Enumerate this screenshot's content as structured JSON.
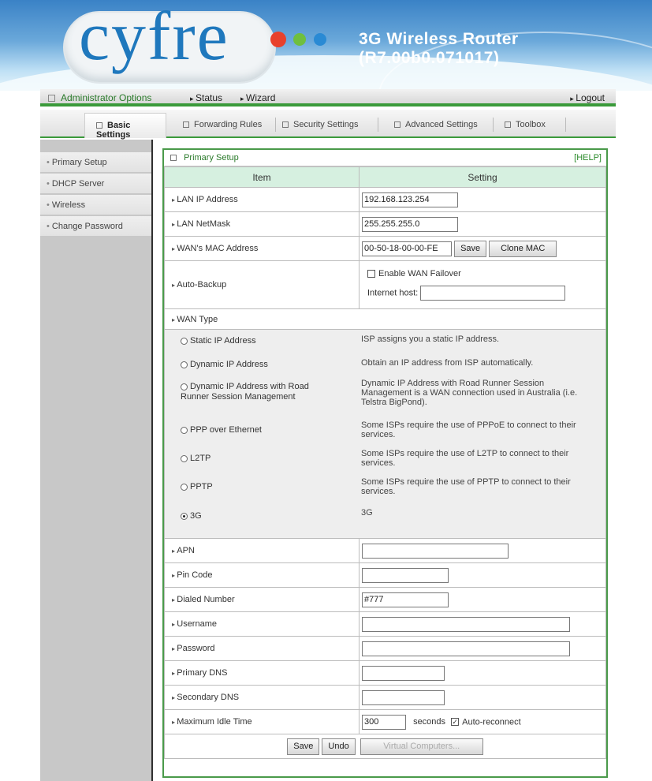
{
  "banner": {
    "logo": "cyfre",
    "product": "3G Wireless Router (R7.00b0.071017)"
  },
  "menu": {
    "admin": "Administrator Options",
    "status": "Status",
    "wizard": "Wizard",
    "logout": "Logout"
  },
  "tabs": [
    "Basic Settings",
    "Forwarding Rules",
    "Security Settings",
    "Advanced Settings",
    "Toolbox"
  ],
  "sidebar": [
    "Primary Setup",
    "DHCP Server",
    "Wireless",
    "Change Password"
  ],
  "panel": {
    "title": "Primary Setup",
    "help": "[HELP]",
    "col_item": "Item",
    "col_setting": "Setting"
  },
  "fields": {
    "lan_ip": {
      "label": "LAN IP Address",
      "value": "192.168.123.254"
    },
    "lan_mask": {
      "label": "LAN NetMask",
      "value": "255.255.255.0"
    },
    "wan_mac": {
      "label": "WAN's MAC Address",
      "value": "00-50-18-00-00-FE",
      "save": "Save",
      "clone": "Clone MAC"
    },
    "auto_backup": {
      "label": "Auto-Backup",
      "failover": "Enable WAN Failover",
      "host_label": "Internet host:",
      "host_value": ""
    },
    "wan_type": {
      "label": "WAN Type"
    },
    "apn": {
      "label": "APN",
      "value": ""
    },
    "pin": {
      "label": "Pin Code",
      "value": ""
    },
    "dialed": {
      "label": "Dialed Number",
      "value": "#777"
    },
    "username": {
      "label": "Username",
      "value": ""
    },
    "password": {
      "label": "Password",
      "value": ""
    },
    "dns1": {
      "label": "Primary DNS",
      "value": ""
    },
    "dns2": {
      "label": "Secondary DNS",
      "value": ""
    },
    "idle": {
      "label": "Maximum Idle Time",
      "value": "300",
      "unit": "seconds",
      "reconnect": "Auto-reconnect"
    }
  },
  "wan_options": [
    {
      "name": "Static IP Address",
      "desc": "ISP assigns you a static IP address.",
      "selected": false
    },
    {
      "name": "Dynamic IP Address",
      "desc": "Obtain an IP address from ISP automatically.",
      "selected": false
    },
    {
      "name": "Dynamic IP Address with Road Runner Session Management",
      "desc": "Dynamic IP Address with Road Runner Session Management is a WAN connection used in Australia (i.e. Telstra BigPond).",
      "selected": false
    },
    {
      "name": "PPP over Ethernet",
      "desc": "Some ISPs require the use of PPPoE to connect to their services.",
      "selected": false
    },
    {
      "name": "L2TP",
      "desc": "Some ISPs require the use of L2TP to connect to their services.",
      "selected": false
    },
    {
      "name": "PPTP",
      "desc": "Some ISPs require the use of PPTP to connect to their services.",
      "selected": false
    },
    {
      "name": "3G",
      "desc": "3G",
      "selected": true
    }
  ],
  "buttons": {
    "save": "Save",
    "undo": "Undo",
    "virtual": "Virtual Computers..."
  }
}
